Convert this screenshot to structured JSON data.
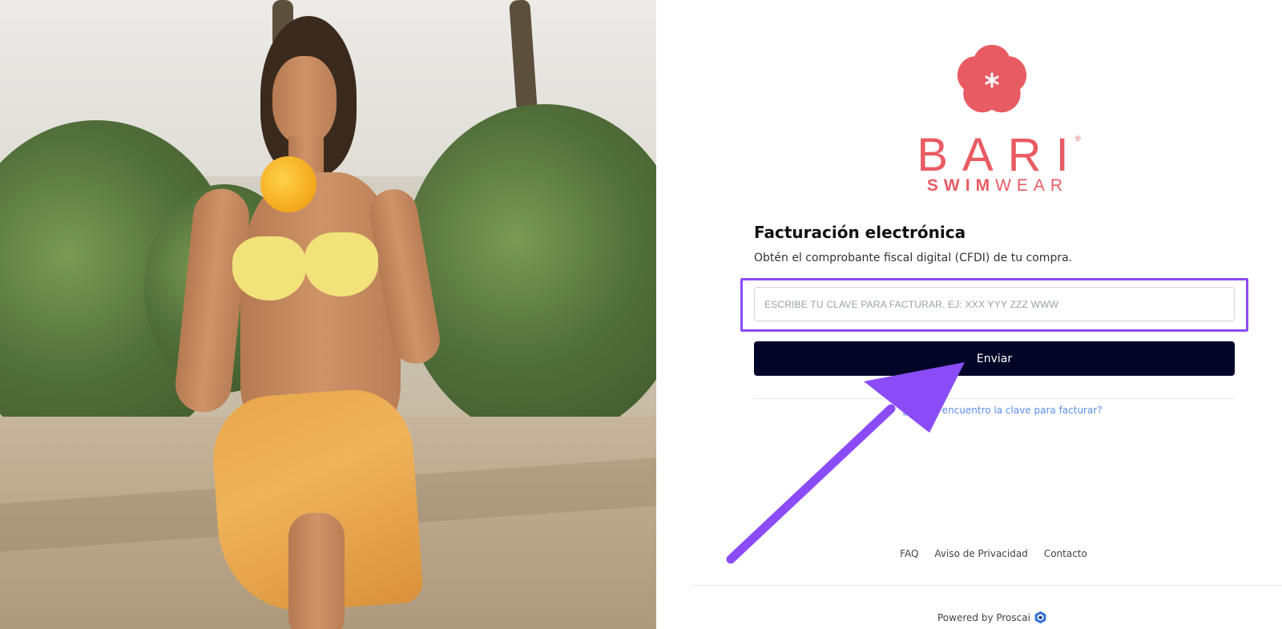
{
  "hero": {
    "description_icon": "hero-photo"
  },
  "brand": {
    "name": "BARI",
    "registered": "®",
    "sub_bold": "SWIM",
    "sub_light": "WEAR",
    "color": "#e95b63"
  },
  "form": {
    "title": "Facturación electrónica",
    "subtitle": "Obtén el comprobante fiscal digital (CFDI) de tu compra.",
    "input_placeholder": "ESCRIBE TU CLAVE PARA FACTURAR. EJ: XXX YYY ZZZ WWW",
    "input_value": "",
    "submit_label": "Enviar",
    "help_link": "¿Dónde encuentro la clave para facturar?",
    "button_color": "#010628",
    "highlight_color": "#8b4cf7"
  },
  "footer": {
    "links": [
      "FAQ",
      "Aviso de Privacidad",
      "Contacto"
    ],
    "powered_by": "Powered by Proscai"
  }
}
